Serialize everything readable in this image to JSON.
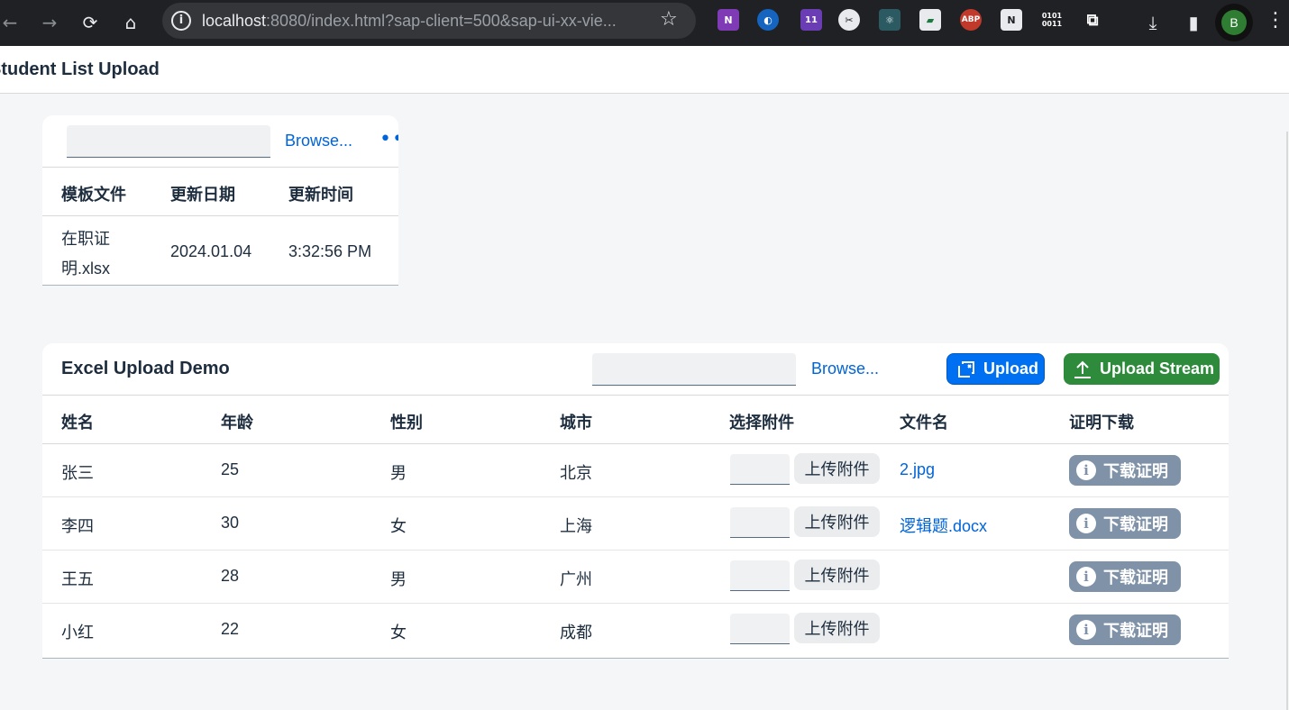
{
  "browser": {
    "url_host": "localhost",
    "url_rest": ":8080/index.html?sap-client=500&sap-ui-xx-vie...",
    "profile_initial": "B",
    "ext_badge": "11"
  },
  "app": {
    "title": "Student List Upload"
  },
  "template_card": {
    "browse_label": "Browse...",
    "columns": [
      "模板文件",
      "更新日期",
      "更新时间"
    ],
    "row": {
      "file_line1": "在职证",
      "file_line2": "明.xlsx",
      "date": "2024.01.04",
      "time": "3:32:56 PM"
    }
  },
  "excel_card": {
    "title": "Excel Upload Demo",
    "browse_label": "Browse...",
    "upload_label": "Upload",
    "upload_stream_label": "Upload Stream",
    "columns": [
      "姓名",
      "年龄",
      "性别",
      "城市",
      "选择附件",
      "文件名",
      "证明下载"
    ],
    "attach_label": "上传附件",
    "download_label": "下载证明",
    "rows": [
      {
        "name": "张三",
        "age": "25",
        "gender": "男",
        "city": "北京",
        "file": "2.jpg"
      },
      {
        "name": "李四",
        "age": "30",
        "gender": "女",
        "city": "上海",
        "file": "逻辑题.docx"
      },
      {
        "name": "王五",
        "age": "28",
        "gender": "男",
        "city": "广州",
        "file": ""
      },
      {
        "name": "小红",
        "age": "22",
        "gender": "女",
        "city": "成都",
        "file": ""
      }
    ]
  },
  "colors": {
    "accent": "#0070f2",
    "success": "#2f8b3c",
    "neutral_button": "#7f92a8",
    "link": "#0064d9"
  }
}
